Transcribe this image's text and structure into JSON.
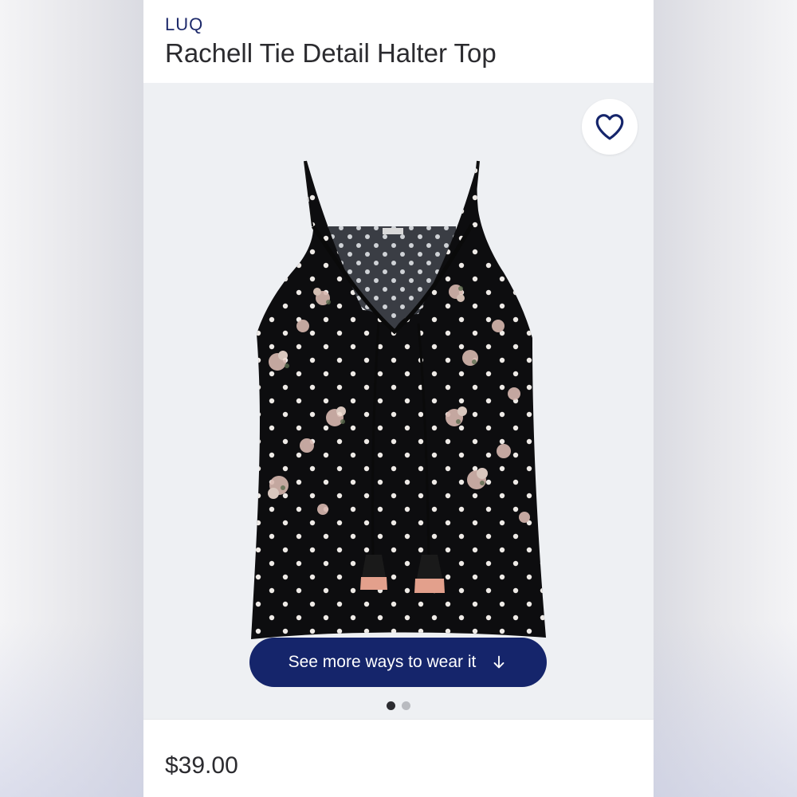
{
  "product": {
    "brand": "LUQ",
    "title": "Rachell Tie Detail Halter Top",
    "price": "$39.00"
  },
  "gallery": {
    "favorite_icon": "heart-outline-icon",
    "see_more_label": "See more ways to wear it",
    "see_more_icon": "arrow-down-icon",
    "image_count": 2,
    "active_index": 0
  },
  "colors": {
    "accent": "#15256b",
    "brand_text": "#1e2a6b",
    "garment": "#0d0d0f"
  }
}
